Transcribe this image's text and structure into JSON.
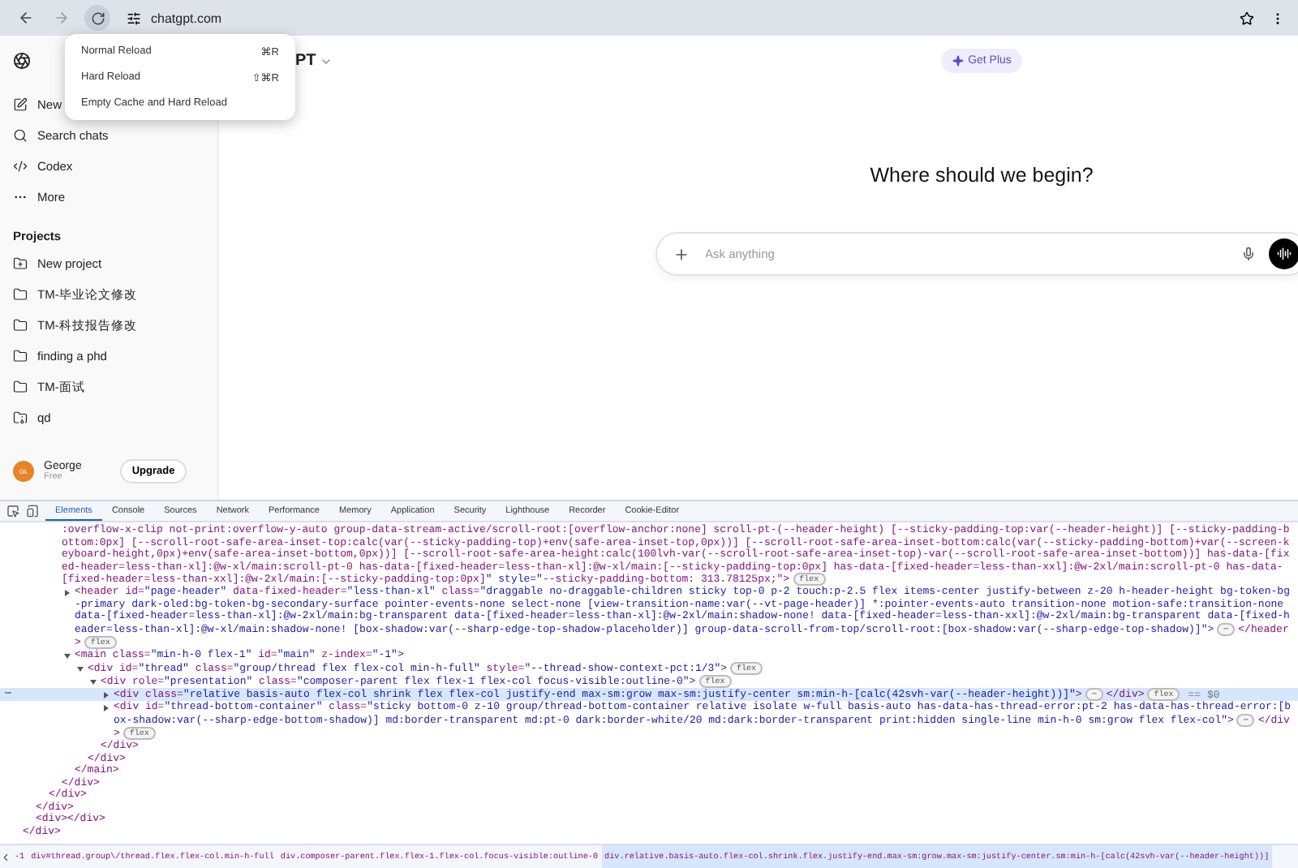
{
  "browser": {
    "address": "chatgpt.com",
    "reload_menu": [
      {
        "label": "Normal Reload",
        "shortcut": "⌘R"
      },
      {
        "label": "Hard Reload",
        "shortcut": "⇧⌘R"
      },
      {
        "label": "Empty Cache and Hard Reload"
      }
    ]
  },
  "sidebar": {
    "items": [
      {
        "label": "New",
        "kind": "new-chat"
      },
      {
        "label": "Search chats",
        "kind": "search"
      },
      {
        "label": "Codex",
        "kind": "codex"
      },
      {
        "label": "More",
        "kind": "more"
      }
    ],
    "projects_heading": "Projects",
    "projects": [
      {
        "label": "New project",
        "kind": "new"
      },
      {
        "label": "TM-毕业论文修改",
        "kind": "folder"
      },
      {
        "label": "TM-科技报告修改",
        "kind": "folder"
      },
      {
        "label": "finding a phd",
        "kind": "folder"
      },
      {
        "label": "TM-面试",
        "kind": "folder"
      },
      {
        "label": "qd",
        "kind": "archive"
      }
    ],
    "user": {
      "initials": "GL",
      "name": "George",
      "plan": "Free"
    },
    "upgrade": "Upgrade"
  },
  "main": {
    "model": "PT",
    "get_plus": "Get Plus",
    "heading": "Where should we begin?",
    "composer": {
      "placeholder": "Ask anything"
    }
  },
  "devtools": {
    "tabs": [
      {
        "label": "Elements",
        "selected": true
      },
      {
        "label": "Console",
        "selected": false
      },
      {
        "label": "Sources",
        "selected": false
      },
      {
        "label": "Network",
        "selected": false
      },
      {
        "label": "Performance",
        "selected": false
      },
      {
        "label": "Memory",
        "selected": false
      },
      {
        "label": "Application",
        "selected": false
      },
      {
        "label": "Security",
        "selected": false
      },
      {
        "label": "Lighthouse",
        "selected": false
      },
      {
        "label": "Recorder",
        "selected": false
      },
      {
        "label": "Cookie-Editor",
        "selected": false
      }
    ],
    "tree": [
      {
        "close": "</div>",
        "children": [
          {
            "close": "</div>",
            "children": [
              {
                "close": "</div>",
                "children": [
                  {
                    "open": ":overflow-x-clip not-print:overflow-y-auto group-data-stream-active/scroll-root:[overflow-anchor:none] scroll-pt-(--header-height) [--sticky-padding-top:var(--header-height)] [--sticky-padding-bottom:0px] [--scroll-root-safe-area-inset-top:calc(var(--sticky-padding-top)+env(safe-area-inset-top,0px))] [--scroll-root-safe-area-inset-bottom:calc(var(--sticky-padding-bottom)+var(--screen-keyboard-height,0px)+env(safe-area-inset-bottom,0px))] [--scroll-root-safe-area-height:calc(100lvh-var(--scroll-root-safe-area-inset-top)-var(--scroll-root-safe-area-inset-bottom))] has-data-[fixed-header=less-than-xl]:@w-xl/main:scroll-pt-0 has-data-[fixed-header=less-than-xl]:@w-xl/main:[--sticky-padding-top:0px] has-data-[fixed-header=less-than-xxl]:@w-2xl/main:scroll-pt-0 has-data-[fixed-header=less-than-xxl]:@w-2xl/main:[--sticky-padding-top:0px]\" style=\"--sticky-padding-bottom: 313.78125px;\">",
                    "badge": "flex",
                    "close": "</div>",
                    "selected": false,
                    "children": [
                      {
                        "open": "<header id=\"page-header\" data-fixed-header=\"less-than-xl\" class=\"draggable no-draggable-children sticky top-0 p-2 touch:p-2.5 flex items-center justify-between z-20 h-header-height bg-token-bg-primary dark-oled:bg-token-bg-secondary-surface pointer-events-none select-none [view-transition-name:var(--vt-page-header)] *:pointer-events-auto transition-none motion-safe:transition-none data-[fixed-header=less-than-xl]:@w-2xl/main:bg-transparent data-[fixed-header=less-than-xl]:@w-2xl/main:shadow-none! data-[fixed-header=less-than-xxl]:@w-2xl/main:bg-transparent data-[fixed-header=less-than-xl]:@w-xl/main:shadow-none! [box-shadow:var(--sharp-edge-top-shadow-placeholder)] group-data-scroll-from-top/scroll-root:[box-shadow:var(--sharp-edge-top-shadow)]\">",
                        "dots": "⋯",
                        "close": "</header>",
                        "badge": "flex",
                        "expanded": false,
                        "selected": false
                      },
                      {
                        "open": "<main class=\"min-h-0 flex-1\" id=\"main\" z-index=\"-1\">",
                        "close": "</main>",
                        "expanded": true,
                        "selected": false,
                        "children": [
                          {
                            "open": "<div id=\"thread\" class=\"group/thread flex flex-col min-h-full\" style=\"--thread-show-context-pct:1/3\">",
                            "badge": "flex",
                            "close": "</div>",
                            "expanded": true,
                            "selected": false,
                            "children": [
                              {
                                "open": "<div role=\"presentation\" class=\"composer-parent flex flex-1 flex-col focus-visible:outline-0\">",
                                "badge": "flex",
                                "close": "</div>",
                                "expanded": true,
                                "selected": false,
                                "children": [
                                  {
                                    "open": "<div class=\"relative basis-auto flex-col shrink flex flex-col justify-end max-sm:grow max-sm:justify-center sm:min-h-[calc(42svh-var(--header-height))]\">",
                                    "dots": "⋯",
                                    "close": "</div>",
                                    "badge": "flex",
                                    "marker": "== $0",
                                    "gutter": "⋯",
                                    "expanded": false,
                                    "selected": true
                                  },
                                  {
                                    "open": "<div id=\"thread-bottom-container\" class=\"sticky bottom-0 z-10 group/thread-bottom-container relative isolate w-full basis-auto has-data-has-thread-error:pt-2 has-data-has-thread-error:[box-shadow:var(--sharp-edge-bottom-shadow)] md:border-transparent md:pt-0 dark:border-white/20 md:dark:border-transparent print:hidden single-line min-h-0 sm:grow flex flex-col\">",
                                    "dots": "⋯",
                                    "close": "</div>",
                                    "badge": "flex",
                                    "expanded": false,
                                    "selected": false
                                  }
                                ]
                              }
                            ]
                          }
                        ]
                      }
                    ]
                  }
                ]
              }
            ]
          },
          {
            "open": "<div></div>",
            "selected": false
          }
        ]
      }
    ],
    "breadcrumbs": [
      {
        "label": "-1",
        "selected": false
      },
      {
        "label": "div#thread.group\\/thread.flex.flex-col.min-h-full",
        "selected": false
      },
      {
        "label": "div.composer-parent.flex.flex-1.flex-col.focus-visible:outline-0",
        "selected": false
      },
      {
        "label": "div.relative.basis-auto.flex-col.shrink.flex.justify-end.max-sm:grow.max-sm:justify-center.sm:min-h-[calc(42svh-var(--header-height))]",
        "selected": true
      }
    ]
  }
}
